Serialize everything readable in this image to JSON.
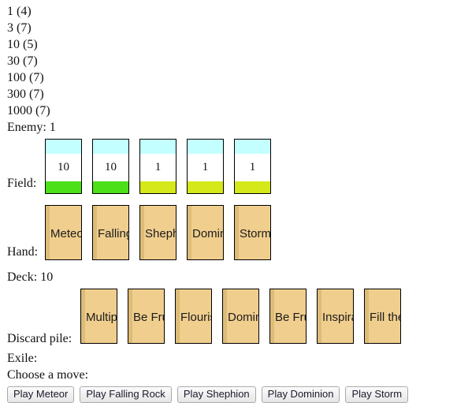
{
  "stats": {
    "lines": [
      "1 (4)",
      "3 (7)",
      "10 (5)",
      "30 (7)",
      "100 (7)",
      "300 (7)",
      "1000 (7)",
      "Enemy: 1"
    ]
  },
  "field": {
    "label": "Field:",
    "cards": [
      {
        "value": "10",
        "top_color": "#c4ffff",
        "bottom_color": "#4ce019"
      },
      {
        "value": "10",
        "top_color": "#c4ffff",
        "bottom_color": "#4ce019"
      },
      {
        "value": "1",
        "top_color": "#c4ffff",
        "bottom_color": "#d4e81a"
      },
      {
        "value": "1",
        "top_color": "#c4ffff",
        "bottom_color": "#d4e81a"
      },
      {
        "value": "1",
        "top_color": "#c4ffff",
        "bottom_color": "#d4e81a"
      }
    ]
  },
  "hand": {
    "label": "Hand:",
    "cards": [
      {
        "name": "Meteor"
      },
      {
        "name": "Falling Rock"
      },
      {
        "name": "Shephion"
      },
      {
        "name": "Dominion"
      },
      {
        "name": "Storm"
      }
    ]
  },
  "deck": {
    "label": "Deck: 10"
  },
  "discard": {
    "label": "Discard pile:",
    "cards": [
      {
        "name": "Multiply"
      },
      {
        "name": "Be Fruitful"
      },
      {
        "name": "Flourish"
      },
      {
        "name": "Dominion"
      },
      {
        "name": "Be Fruitful"
      },
      {
        "name": "Inspiration"
      },
      {
        "name": "Fill the Earth"
      }
    ]
  },
  "exile": {
    "label": "Exile:"
  },
  "prompt": {
    "label": "Choose a move:"
  },
  "moves": {
    "buttons": [
      {
        "label": "Play Meteor"
      },
      {
        "label": "Play Falling Rock"
      },
      {
        "label": "Play Shephion"
      },
      {
        "label": "Play Dominion"
      },
      {
        "label": "Play Storm"
      }
    ]
  }
}
